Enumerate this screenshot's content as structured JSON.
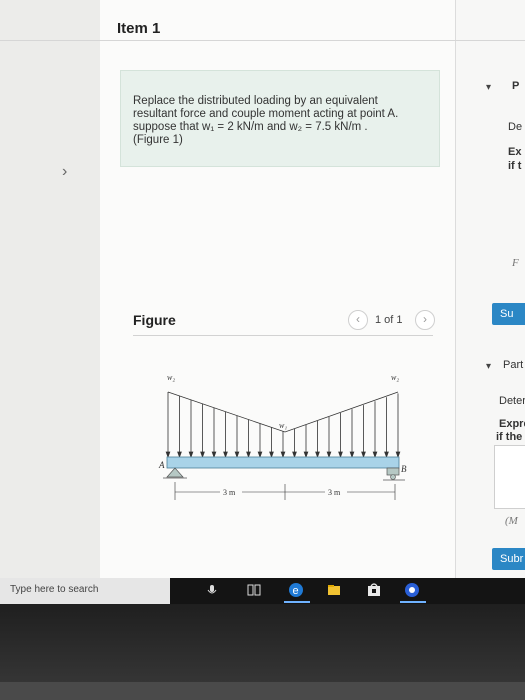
{
  "page": {
    "item_title": "Item 1",
    "prev_arrow": "›"
  },
  "question": {
    "line1": "Replace the distributed loading by an equivalent",
    "line2": "resultant force and couple moment acting at point A.",
    "line3": "suppose that w₁ = 2  kN/m and w₂ = 7.5  kN/m .",
    "figure_link": "(Figure 1)"
  },
  "figure": {
    "label": "Figure",
    "counter": "1 of 1",
    "prev": "‹",
    "next": "›",
    "diagram": {
      "w2_left": "w₂",
      "w1": "w₁",
      "w2_right": "w₂",
      "point_a": "A",
      "point_b": "B",
      "dim_left": "3 m",
      "dim_right": "3 m"
    }
  },
  "right_panel": {
    "caret1": "▾",
    "p_label": "P",
    "de": "De",
    "ex": "Ex",
    "ift": "if t",
    "f_label": "F",
    "btn1": "Su",
    "caret2": "▾",
    "part": "Part",
    "deter": "Deter",
    "expre": "Expre",
    "if_the": "if the",
    "m_label": "(M",
    "submit": "Subr"
  },
  "taskbar": {
    "search_placeholder": "Type here to search"
  }
}
